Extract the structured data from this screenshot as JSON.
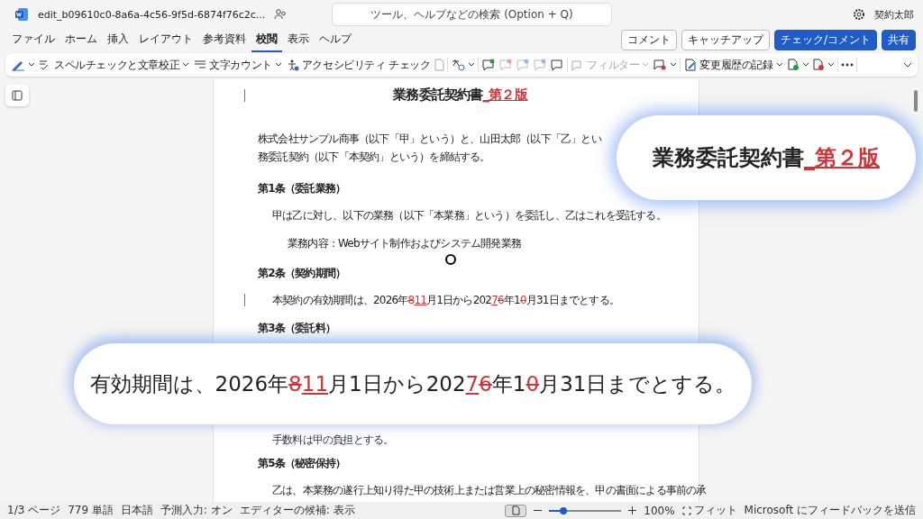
{
  "title_bar": {
    "file_name": "edit_b09610c0-8a6a-4c56-9f5d-6874f76c2c...",
    "search": {
      "placeholder": "ツール、ヘルプなどの検索 (Option + Q)"
    },
    "user": "契約太郎"
  },
  "menu_tabs": [
    {
      "label": "ファイル",
      "selected": false
    },
    {
      "label": "ホーム",
      "selected": false
    },
    {
      "label": "挿入",
      "selected": false
    },
    {
      "label": "レイアウト",
      "selected": false
    },
    {
      "label": "参考資料",
      "selected": false
    },
    {
      "label": "校閲",
      "selected": true
    },
    {
      "label": "表示",
      "selected": false
    },
    {
      "label": "ヘルプ",
      "selected": false
    }
  ],
  "header_buttons": [
    {
      "label": "コメント",
      "kind": "outline"
    },
    {
      "label": "キャッチアップ",
      "kind": "outline"
    },
    {
      "label": "チェック/コメント",
      "kind": "primary"
    },
    {
      "label": "共有",
      "kind": "primary"
    }
  ],
  "ribbon": {
    "spelling": "スペルチェックと文章校正",
    "word_count": "文字カウント",
    "accessibility": "アクセシビリティ チェック",
    "filter": {
      "label": "フィルター",
      "disabled": true
    },
    "track_changes": "変更履歴の記録"
  },
  "document": {
    "title": [
      {
        "text": "業務委託契約書",
        "kind": "plain"
      },
      {
        "text": "_第２版",
        "kind": "inserted"
      }
    ],
    "title_change_bar": true,
    "paragraphs": [
      {
        "kind": "body",
        "change_bar": false,
        "segments": [
          {
            "text": "株式会社サンプル商事（以下「甲」という）と、山田太郎（以下「乙」とい",
            "kind": "plain"
          }
        ]
      },
      {
        "kind": "body-cont",
        "change_bar": false,
        "segments": [
          {
            "text": "務委託契約（以下「本契約」という）を締結する。",
            "kind": "plain"
          }
        ]
      },
      {
        "kind": "heading",
        "change_bar": false,
        "segments": [
          {
            "text": "第1条（委託業務）",
            "kind": "plain"
          }
        ]
      },
      {
        "kind": "indent1",
        "change_bar": false,
        "segments": [
          {
            "text": "甲は乙に対し、以下の業務（以下「本業務」という）を委託し、乙はこれを受託する。",
            "kind": "plain"
          }
        ]
      },
      {
        "kind": "indent2",
        "change_bar": false,
        "segments": [
          {
            "text": "業務内容：Webサイト制作およびシステム開発業務",
            "kind": "plain"
          }
        ]
      },
      {
        "kind": "heading",
        "change_bar": false,
        "segments": [
          {
            "text": "第2条（契約期間）",
            "kind": "plain"
          }
        ]
      },
      {
        "kind": "indent1",
        "change_bar": true,
        "segments": [
          {
            "text": "本契約の有効期間は、2026年",
            "kind": "plain"
          },
          {
            "text": "8",
            "kind": "deleted"
          },
          {
            "text": "11",
            "kind": "inserted"
          },
          {
            "text": "月1日から202",
            "kind": "plain"
          },
          {
            "text": "7",
            "kind": "inserted"
          },
          {
            "text": "6",
            "kind": "deleted"
          },
          {
            "text": "年1",
            "kind": "plain"
          },
          {
            "text": "0",
            "kind": "deleted"
          },
          {
            "text": "月31日までとする。",
            "kind": "plain"
          }
        ]
      },
      {
        "kind": "heading",
        "change_bar": false,
        "segments": [
          {
            "text": "第3条（委託料）",
            "kind": "plain"
          }
        ]
      },
      {
        "kind": "indent1-gap",
        "change_bar": false,
        "segments": [
          {
            "text": "手数料は甲の負担とする。",
            "kind": "plain"
          }
        ]
      },
      {
        "kind": "heading",
        "change_bar": false,
        "segments": [
          {
            "text": "第5条（秘密保持）",
            "kind": "plain"
          }
        ]
      },
      {
        "kind": "indent1",
        "change_bar": false,
        "segments": [
          {
            "text": "乙は、本業務の遂行上知り得た甲の技術上または営業上の秘密情報を、甲の書面による事前の承",
            "kind": "plain"
          }
        ]
      }
    ]
  },
  "callouts": [
    {
      "kind": "top",
      "segments": [
        {
          "text": "業務委託契約書",
          "kind": "plain"
        },
        {
          "text": "_第２版",
          "kind": "inserted"
        }
      ]
    },
    {
      "kind": "bottom",
      "segments": [
        {
          "text": "有効期間は、2026年",
          "kind": "plain"
        },
        {
          "text": "8",
          "kind": "deleted"
        },
        {
          "text": "11",
          "kind": "inserted"
        },
        {
          "text": "月1日から202",
          "kind": "plain"
        },
        {
          "text": "7",
          "kind": "inserted"
        },
        {
          "text": "6",
          "kind": "deleted"
        },
        {
          "text": "年1",
          "kind": "plain"
        },
        {
          "text": "0",
          "kind": "deleted"
        },
        {
          "text": "月31日までとする。",
          "kind": "plain"
        }
      ]
    }
  ],
  "status_bar": {
    "items": [
      "1/3 ページ",
      "779 単語",
      "日本語",
      "予測入力: オン",
      "エディターの候補: 表示"
    ],
    "zoom": {
      "level": 0.2,
      "reading": "100%"
    },
    "fit": "フィット",
    "feedback": "Microsoft にフィードバックを送信"
  }
}
